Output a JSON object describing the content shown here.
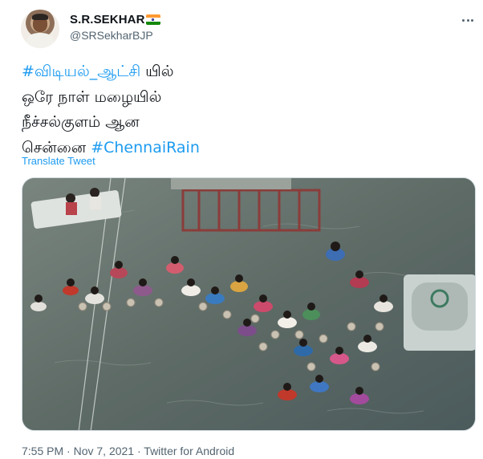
{
  "author": {
    "display_name": "S.R.SEKHAR",
    "handle": "@SRSekharBJP"
  },
  "tweet": {
    "hashtag_1": "#விடியல்_ஆட்சி",
    "text_after_hashtag_1": " யில்",
    "line_2": "ஒரே நாள் மழையில்",
    "line_3": "நீச்சல்குளம் ஆன",
    "line_4_prefix": "சென்னை ",
    "hashtag_2": "#ChennaiRain",
    "translate_label": "Translate Tweet"
  },
  "meta": {
    "time": "7:55 PM",
    "separator": " · ",
    "date": "Nov 7, 2021",
    "source": "Twitter for Android"
  },
  "colors": {
    "link": "#1d9bf0",
    "secondary_text": "#536471",
    "primary_text": "#0f1419",
    "media_border": "#cfd9de"
  },
  "icons": {
    "flag": "india-flag-icon",
    "more": "more-options-icon"
  }
}
